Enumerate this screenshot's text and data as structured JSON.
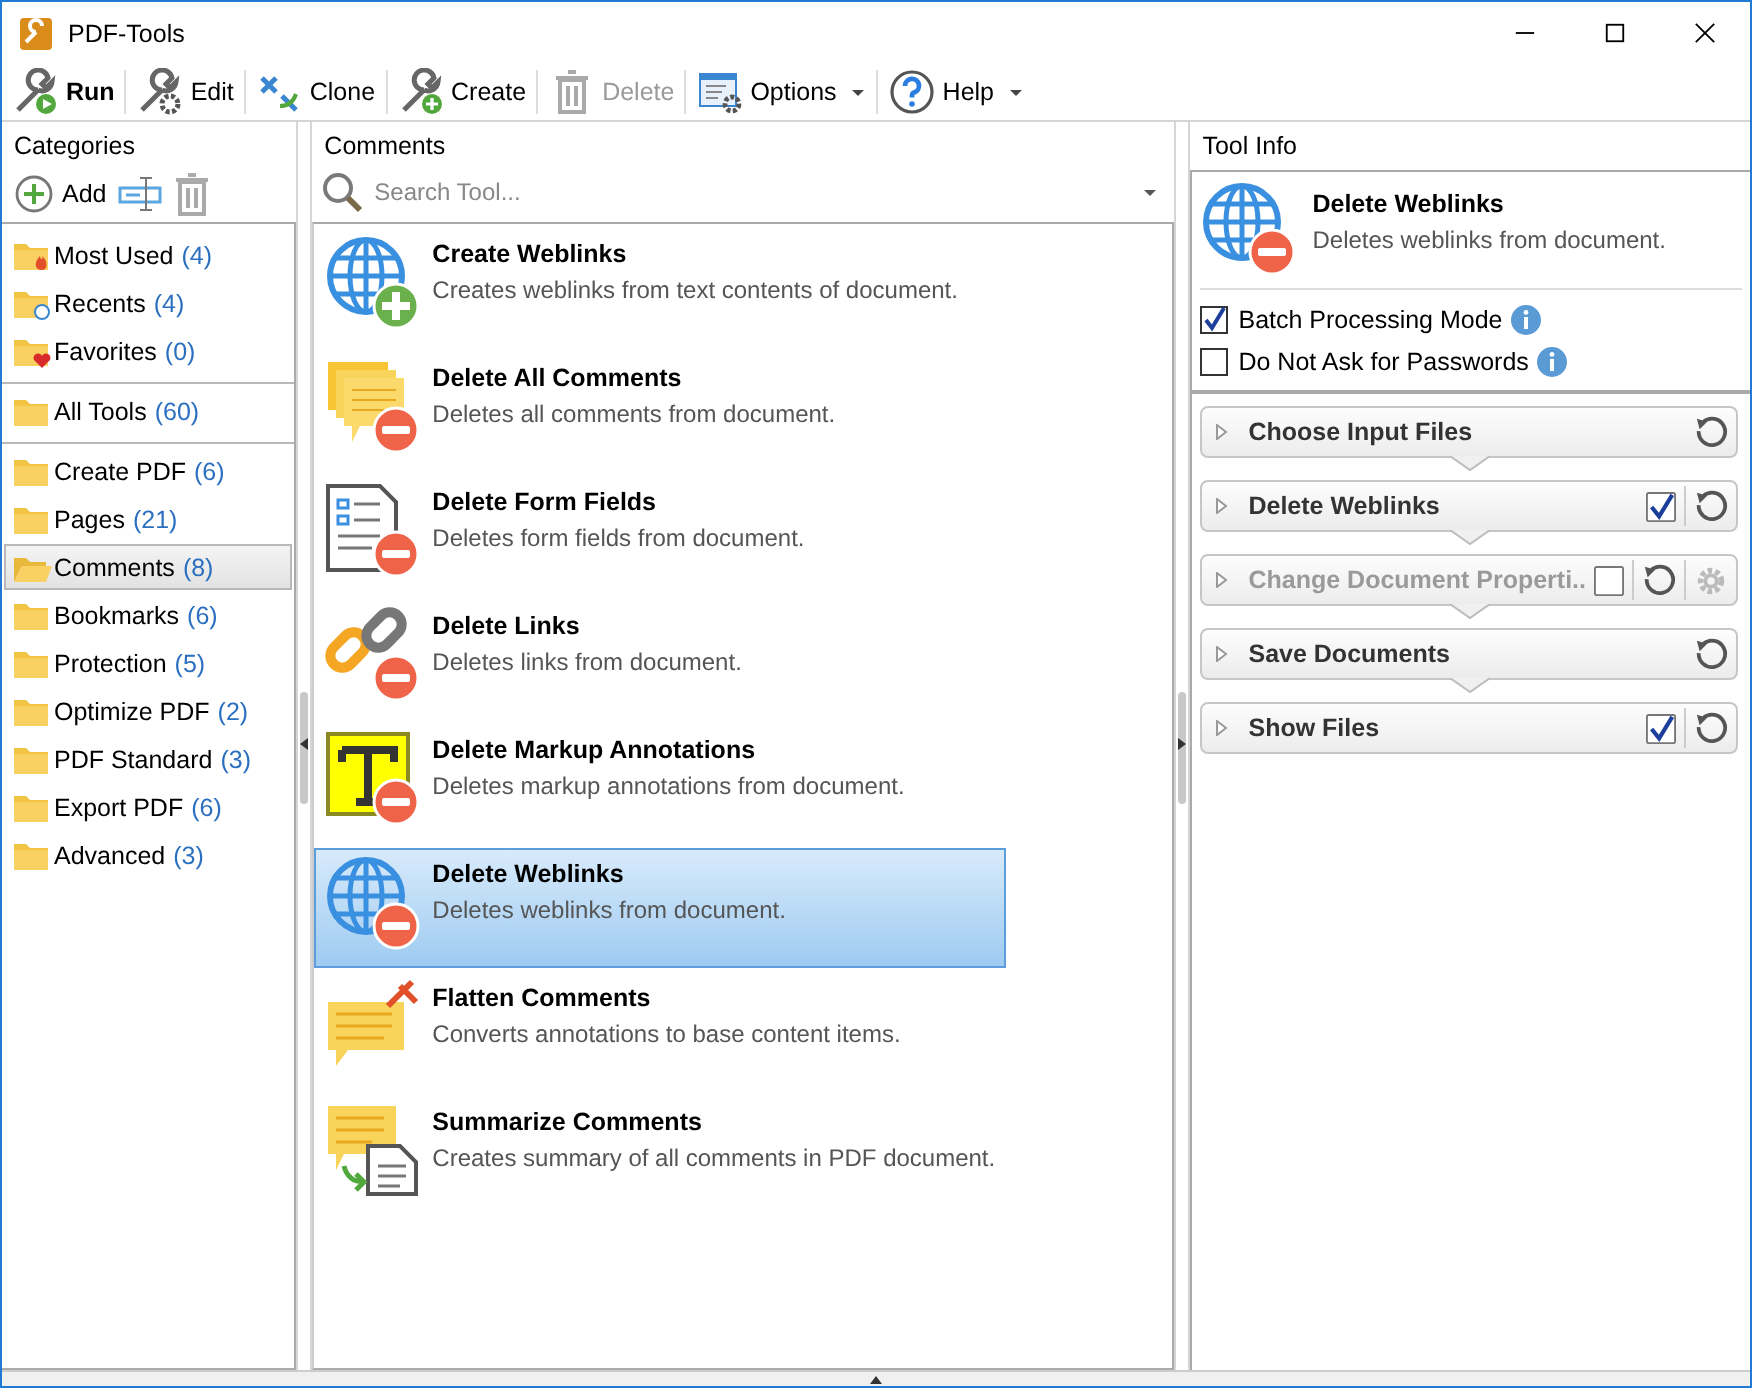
{
  "window": {
    "title": "PDF-Tools"
  },
  "toolbar": [
    {
      "label": "Run",
      "kind": "run",
      "primary": true,
      "disabled": false,
      "dropdown": false
    },
    {
      "label": "Edit",
      "kind": "edit",
      "primary": false,
      "disabled": false,
      "dropdown": false
    },
    {
      "label": "Clone",
      "kind": "clone",
      "primary": false,
      "disabled": false,
      "dropdown": false
    },
    {
      "label": "Create",
      "kind": "create",
      "primary": false,
      "disabled": false,
      "dropdown": false
    },
    {
      "label": "Delete",
      "kind": "delete",
      "primary": false,
      "disabled": true,
      "dropdown": false
    },
    {
      "label": "Options",
      "kind": "options",
      "primary": false,
      "disabled": false,
      "dropdown": true
    },
    {
      "label": "Help",
      "kind": "help",
      "primary": false,
      "disabled": false,
      "dropdown": true
    }
  ],
  "categories": {
    "title": "Categories",
    "add_label": "Add",
    "groups": [
      [
        {
          "name": "Most Used",
          "count": "(4)",
          "kind": "fire",
          "selected": false
        },
        {
          "name": "Recents",
          "count": "(4)",
          "kind": "clock",
          "selected": false
        },
        {
          "name": "Favorites",
          "count": "(0)",
          "kind": "heart",
          "selected": false
        }
      ],
      [
        {
          "name": "All Tools",
          "count": "(60)",
          "kind": "folder",
          "selected": false
        }
      ],
      [
        {
          "name": "Create PDF",
          "count": "(6)",
          "kind": "folder",
          "selected": false
        },
        {
          "name": "Pages",
          "count": "(21)",
          "kind": "folder",
          "selected": false
        },
        {
          "name": "Comments",
          "count": "(8)",
          "kind": "open",
          "selected": true
        },
        {
          "name": "Bookmarks",
          "count": "(6)",
          "kind": "folder",
          "selected": false
        },
        {
          "name": "Protection",
          "count": "(5)",
          "kind": "folder",
          "selected": false
        },
        {
          "name": "Optimize PDF",
          "count": "(2)",
          "kind": "folder",
          "selected": false
        },
        {
          "name": "PDF Standard",
          "count": "(3)",
          "kind": "folder",
          "selected": false
        },
        {
          "name": "Export PDF",
          "count": "(6)",
          "kind": "folder",
          "selected": false
        },
        {
          "name": "Advanced",
          "count": "(3)",
          "kind": "folder",
          "selected": false
        }
      ]
    ]
  },
  "tools": {
    "title": "Comments",
    "search": {
      "placeholder": "Search Tool..."
    },
    "items": [
      {
        "name": "Create Weblinks",
        "description": "Creates weblinks from text contents of document.",
        "kind": "addglobe",
        "selected": false
      },
      {
        "name": "Delete All Comments",
        "description": "Deletes all comments from document.",
        "kind": "removecomments",
        "selected": false
      },
      {
        "name": "Delete Form Fields",
        "description": "Deletes form fields from document.",
        "kind": "removeform",
        "selected": false
      },
      {
        "name": "Delete Links",
        "description": "Deletes links from document.",
        "kind": "removelink",
        "selected": false
      },
      {
        "name": "Delete Markup Annotations",
        "description": "Deletes markup annotations from document.",
        "kind": "removemarkup",
        "selected": false
      },
      {
        "name": "Delete Weblinks",
        "description": "Deletes weblinks from document.",
        "kind": "removeglobe",
        "selected": true
      },
      {
        "name": "Flatten Comments",
        "description": "Converts annotations to base content items.",
        "kind": "flatten",
        "selected": false
      },
      {
        "name": "Summarize Comments",
        "description": "Creates summary of all comments in PDF document.",
        "kind": "summarize",
        "selected": false
      }
    ]
  },
  "tool_info": {
    "title": "Tool Info",
    "name": "Delete Weblinks",
    "description": "Deletes weblinks from document.",
    "options": [
      {
        "label": "Batch Processing Mode",
        "checked": true
      },
      {
        "label": "Do Not Ask for Passwords",
        "checked": false
      }
    ],
    "steps": [
      {
        "label": "Choose Input Files",
        "disabled": false,
        "settings": false
      },
      {
        "label": "Delete Weblinks",
        "disabled": false,
        "settings": false,
        "checked": true
      },
      {
        "label": "Change Document Properti..",
        "disabled": true,
        "settings": true,
        "checked": false
      },
      {
        "label": "Save Documents",
        "disabled": false,
        "settings": false
      },
      {
        "label": "Show Files",
        "disabled": false,
        "settings": false,
        "checked": true
      }
    ]
  }
}
